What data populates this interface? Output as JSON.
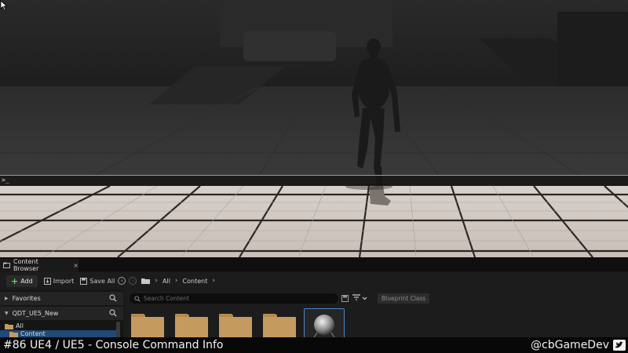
{
  "viewport": {
    "console_prompt": ">_"
  },
  "content_browser": {
    "tab_label": "Content Browser",
    "tab_close": "×",
    "toolbar": {
      "add_label": "Add",
      "import_label": "Import",
      "save_all_label": "Save All",
      "breadcrumb": [
        "All",
        "Content"
      ]
    },
    "left_panel": {
      "favorites_label": "Favorites",
      "project_label": "QDT_UE5_New",
      "tree": [
        "All",
        "Content"
      ]
    },
    "search_placeholder": "Search Content",
    "filter_label": "Blueprint Class"
  },
  "overlay": {
    "title": "#86 UE4 / UE5 - Console Command Info",
    "handle": "@cbGameDev"
  },
  "colors": {
    "folder": "#c59a5e",
    "selection": "#1f4a78",
    "add_plus": "#5fd35f"
  },
  "icons": [
    "content-browser-icon",
    "close-icon",
    "add-icon",
    "import-icon",
    "save-icon",
    "back-icon",
    "forward-icon",
    "folder-icon",
    "chevron-right-icon",
    "search-icon",
    "filter-icon",
    "twitter-icon",
    "mouse-cursor-icon"
  ]
}
